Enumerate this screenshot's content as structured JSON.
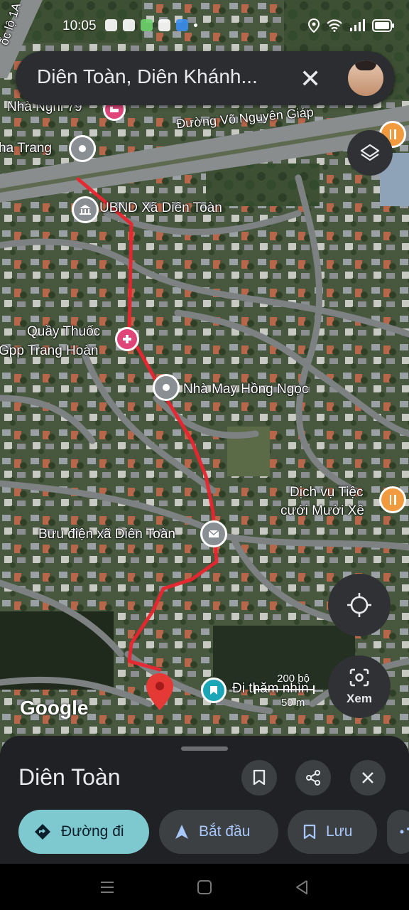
{
  "status": {
    "time": "10:05"
  },
  "search": {
    "query": "Diên Toàn, Diên Khánh...",
    "clear_label": "✕"
  },
  "map": {
    "labels": {
      "ql1a": "ốc lộ 1A",
      "nha_nghi": "Nhà Nghỉ 79",
      "nha_trang": "ha Trang",
      "road_vng": "Đường Võ Nguyên Giáp",
      "ubnd": "UBND Xã Diên Toàn",
      "pharmacy_line1": "Quầy Thuốc",
      "pharmacy_line2": "Gpp Trang Hoàn",
      "nha_may": "Nhà May Hồng Ngọc",
      "tiec_line1": "Dịch vụ Tiệc",
      "tiec_line2": "cưới Mười Xê",
      "buu_dien": "Bưu điện xã Diên Toàn",
      "di_tham": "Đi thăm nhìn"
    },
    "scale": {
      "ft": "200 bộ",
      "m": "50 m"
    },
    "google": "Google",
    "lens_label": "Xem"
  },
  "sheet": {
    "title": "Diên Toàn",
    "buttons": {
      "directions": "Đường đi",
      "start": "Bắt đầu",
      "save": "Lưu"
    }
  },
  "colors": {
    "route": "#e8262f",
    "chip_primary": "#7ec8cf",
    "sheet_bg": "#202124"
  }
}
